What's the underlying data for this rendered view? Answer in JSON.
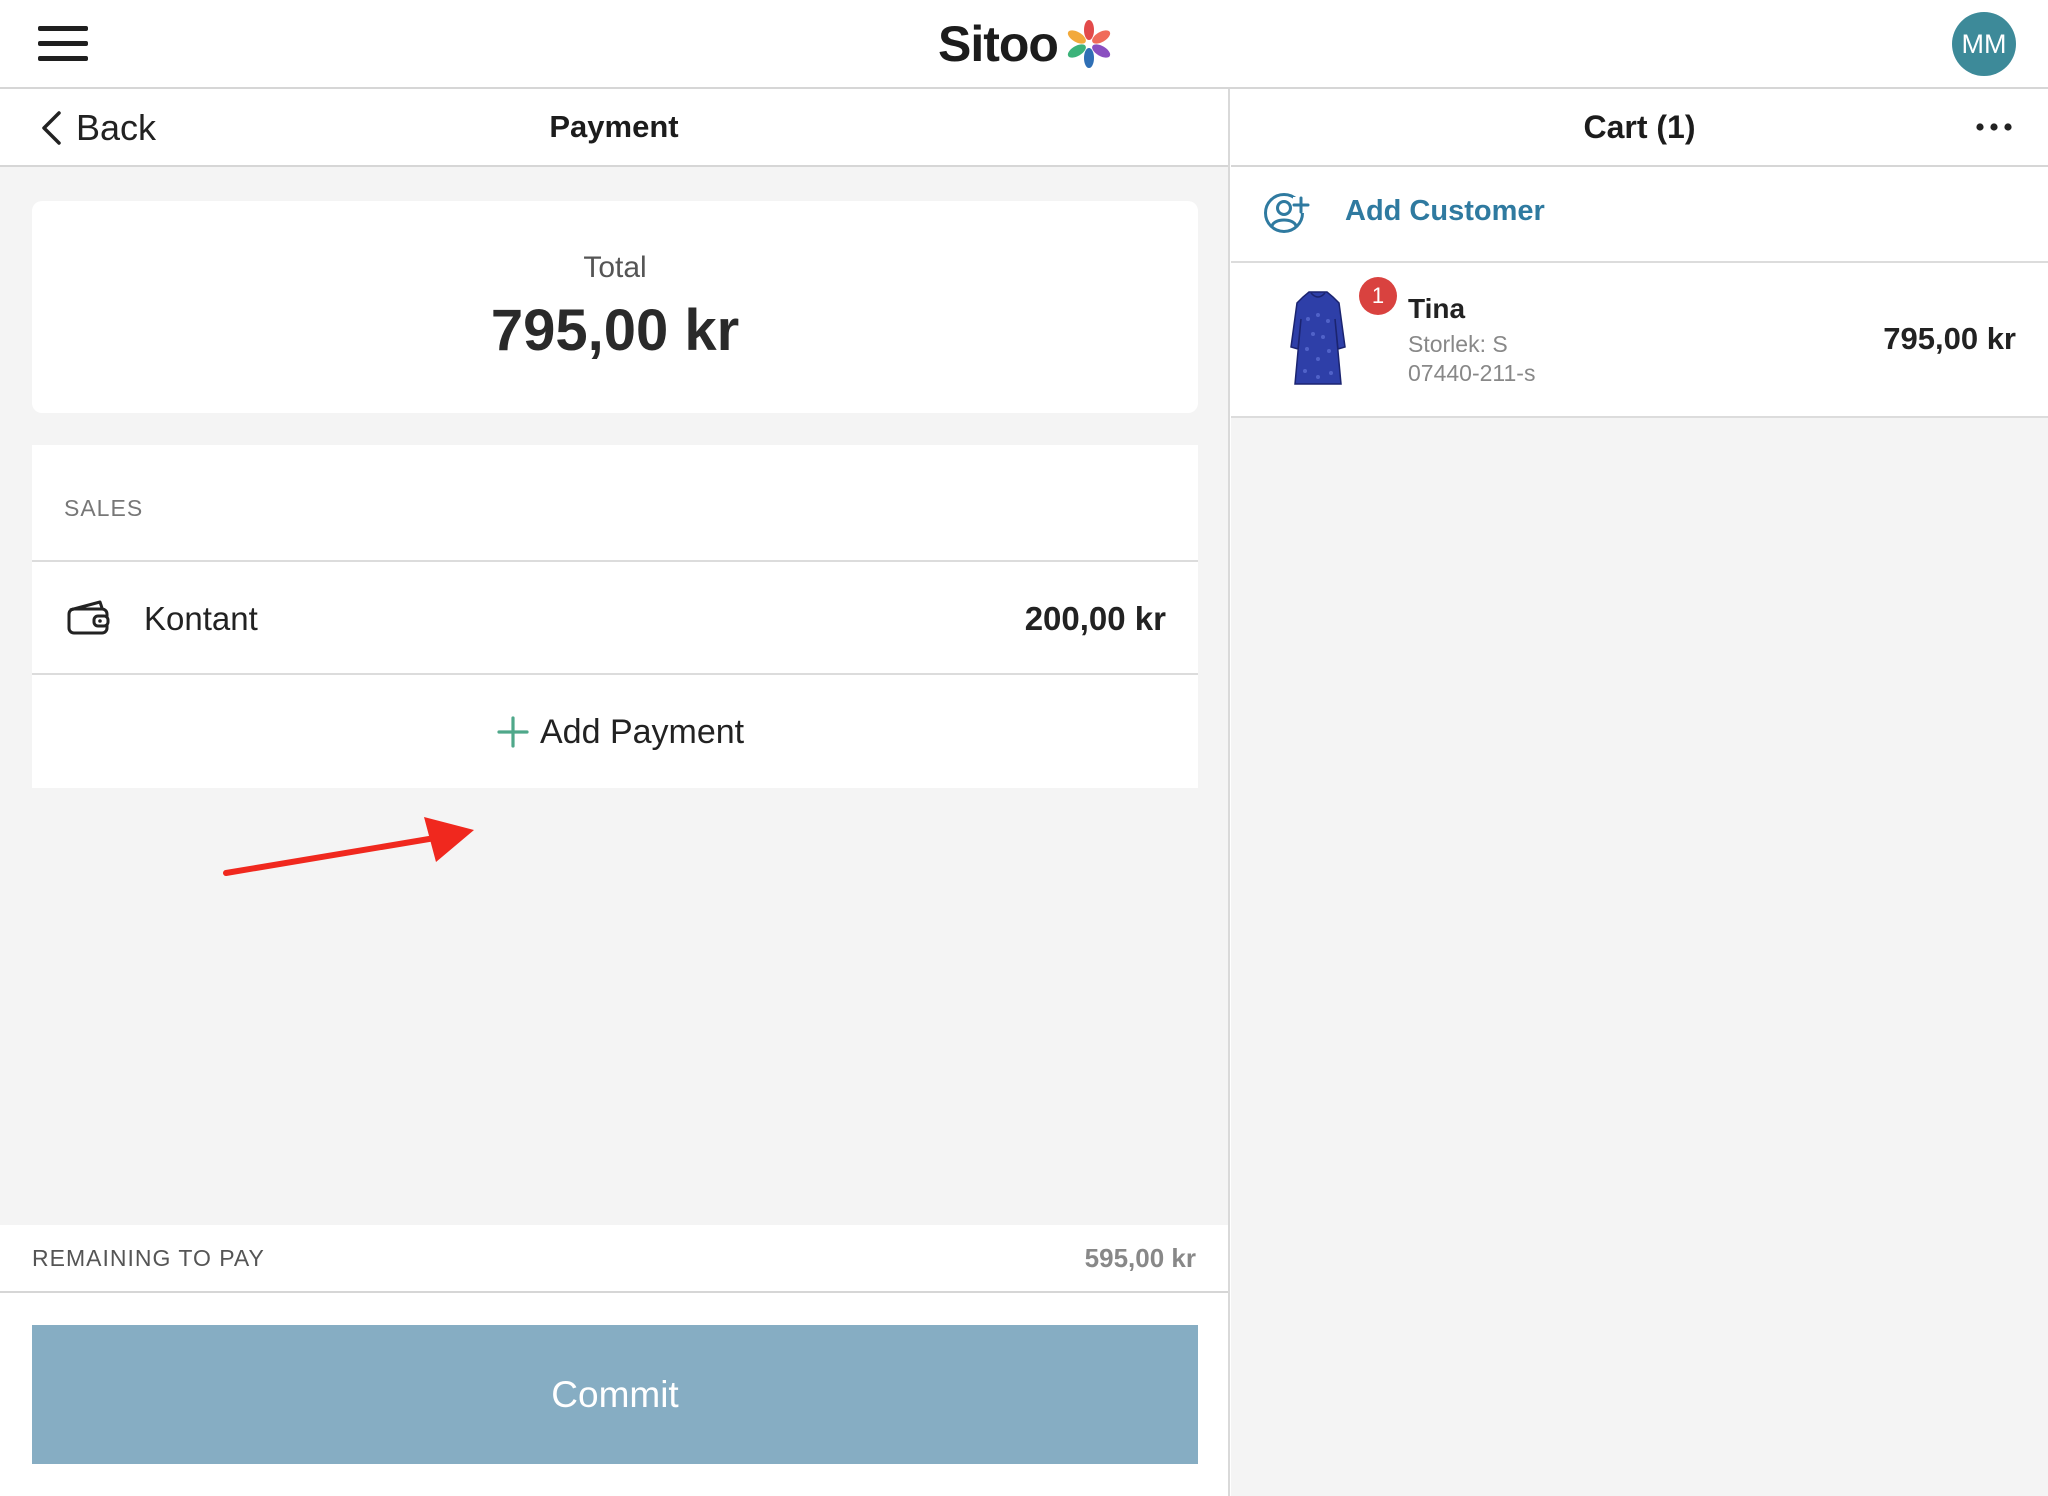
{
  "app": {
    "logo_text": "Sitoo",
    "user_initials": "MM"
  },
  "payment": {
    "back_label": "Back",
    "title": "Payment",
    "total_label": "Total",
    "total_amount": "795,00 kr",
    "sales_header": "SALES",
    "payments": [
      {
        "icon": "wallet-icon",
        "name": "Kontant",
        "amount": "200,00 kr"
      }
    ],
    "add_payment_label": "Add Payment",
    "remaining_label": "REMAINING TO PAY",
    "remaining_amount": "595,00 kr",
    "commit_label": "Commit"
  },
  "cart": {
    "title": "Cart (1)",
    "add_customer_label": "Add Customer",
    "items": [
      {
        "name": "Tina",
        "size": "Storlek: S",
        "sku": "07440-211-s",
        "quantity": "1",
        "price": "795,00 kr"
      }
    ]
  },
  "colors": {
    "accent": "#2f7aa0",
    "commit_button": "#86adc3",
    "avatar": "#3d8a99",
    "badge": "#d9423f",
    "plus_icon": "#4fa88a",
    "annotation_arrow": "#f0281e"
  },
  "annotation": {
    "arrow_target": "add-payment-button"
  }
}
